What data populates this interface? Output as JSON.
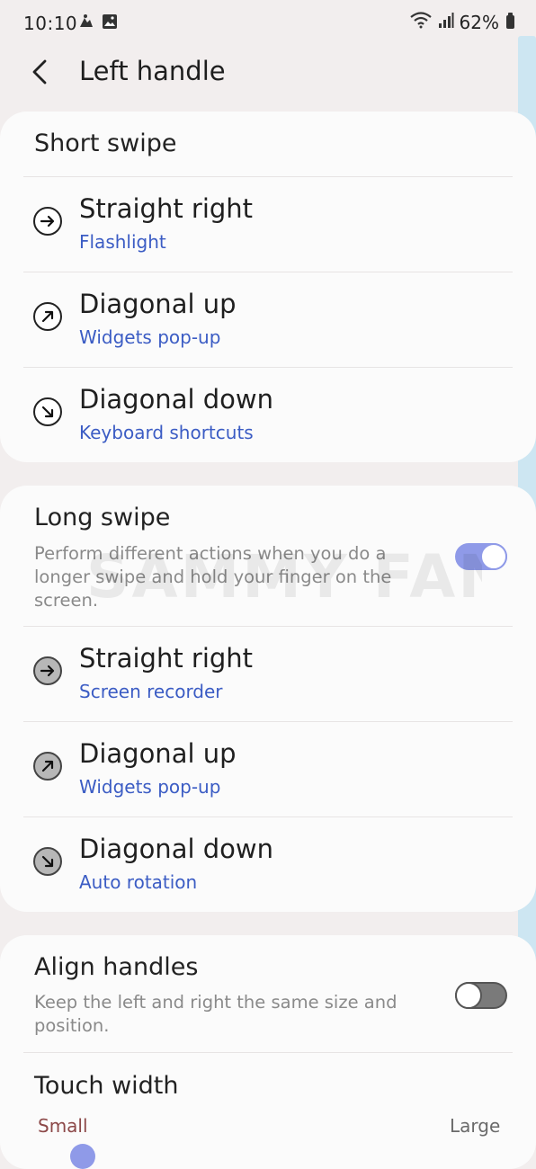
{
  "status_bar": {
    "time": "10:10",
    "battery": "62%"
  },
  "header": {
    "title": "Left handle"
  },
  "short_swipe": {
    "title": "Short swipe",
    "items": [
      {
        "label": "Straight right",
        "action": "Flashlight",
        "icon": "arrow-right-icon"
      },
      {
        "label": "Diagonal up",
        "action": "Widgets pop-up",
        "icon": "arrow-up-right-icon"
      },
      {
        "label": "Diagonal down",
        "action": "Keyboard shortcuts",
        "icon": "arrow-down-right-icon"
      }
    ]
  },
  "long_swipe": {
    "title": "Long swipe",
    "description": "Perform different actions when you do a longer swipe and hold your finger on the screen.",
    "enabled": true,
    "items": [
      {
        "label": "Straight right",
        "action": "Screen recorder",
        "icon": "arrow-right-icon"
      },
      {
        "label": "Diagonal up",
        "action": "Widgets pop-up",
        "icon": "arrow-up-right-icon"
      },
      {
        "label": "Diagonal down",
        "action": "Auto rotation",
        "icon": "arrow-down-right-icon"
      }
    ]
  },
  "align_handles": {
    "title": "Align handles",
    "description": "Keep the left and right the same size and position.",
    "enabled": false
  },
  "touch_width": {
    "title": "Touch width",
    "min_label": "Small",
    "max_label": "Large"
  },
  "watermark": "SAMMY FANS",
  "colors": {
    "accent": "#8f9ae8",
    "link": "#3b5cc4",
    "background": "#f2eeee",
    "card": "#fbfbfb"
  }
}
